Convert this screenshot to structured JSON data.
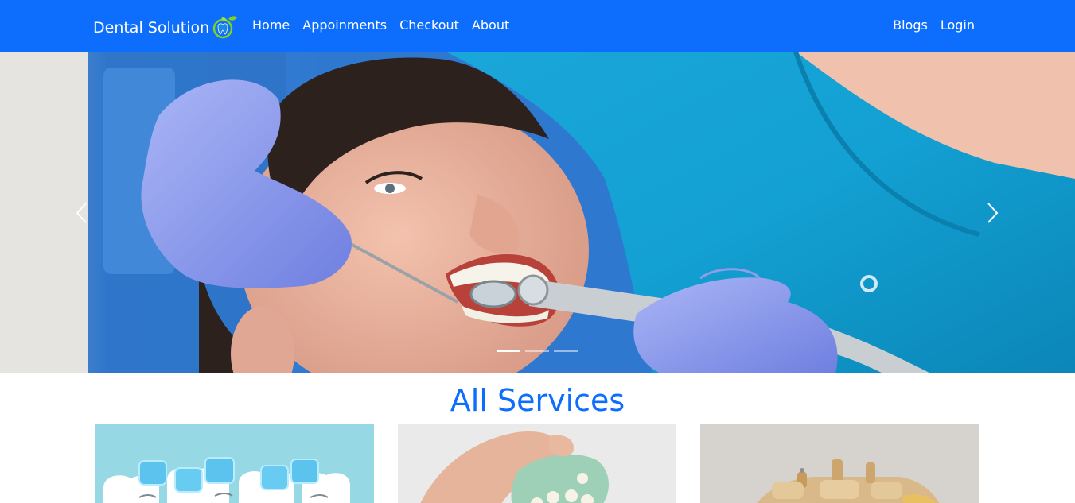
{
  "navbar": {
    "brand": "Dental Solution",
    "links_left": [
      "Home",
      "Appoinments",
      "Checkout",
      "About"
    ],
    "links_right": [
      "Blogs",
      "Login"
    ],
    "background": "#0d6efd"
  },
  "carousel": {
    "slide_count": 3,
    "active_index": 0,
    "image": "dentist-examining-patient"
  },
  "services": {
    "title": "All Services",
    "title_color": "#0d6efd",
    "cards": [
      {
        "image": "teeth-illustration"
      },
      {
        "image": "dental-prosthesis-in-hand"
      },
      {
        "image": "dental-implant-model"
      }
    ]
  },
  "icons": {
    "logo": "tooth-leaf-logo-icon",
    "prev": "chevron-left-icon",
    "next": "chevron-right-icon"
  }
}
